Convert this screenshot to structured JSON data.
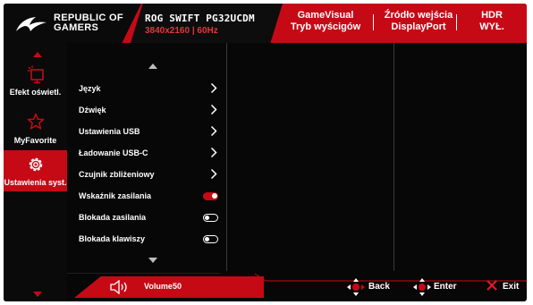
{
  "header": {
    "brand_line1": "REPUBLIC OF",
    "brand_line2": "GAMERS",
    "model": "ROG SWIFT PG32UCDM",
    "resolution": "3840x2160 | 60Hz",
    "preset_line1": "GameVisual",
    "preset_line2": "Tryb wyścigów",
    "input_line1": "Źródło wejścia",
    "input_line2": "DisplayPort",
    "hdr_line1": "HDR",
    "hdr_line2": "WYŁ."
  },
  "nav": {
    "items": [
      {
        "label": "Efekt oświetl.",
        "icon": "lighting-effect-icon",
        "active": false
      },
      {
        "label": "MyFavorite",
        "icon": "star-icon",
        "active": false
      },
      {
        "label": "Ustawienia syst.",
        "icon": "gear-icon",
        "active": true
      }
    ]
  },
  "menu": {
    "items": [
      {
        "label": "Język",
        "control": "submenu"
      },
      {
        "label": "Dźwięk",
        "control": "submenu"
      },
      {
        "label": "Ustawienia USB",
        "control": "submenu"
      },
      {
        "label": "Ładowanie USB-C",
        "control": "submenu"
      },
      {
        "label": "Czujnik zbliżeniowy",
        "control": "submenu"
      },
      {
        "label": "Wskaźnik zasilania",
        "control": "toggle",
        "on": true
      },
      {
        "label": "Blokada zasilania",
        "control": "toggle",
        "on": false
      },
      {
        "label": "Blokada klawiszy",
        "control": "toggle",
        "on": false
      }
    ]
  },
  "footer": {
    "volume_label": "Volume",
    "volume_value": "50",
    "back_label": "Back",
    "enter_label": "Enter",
    "exit_label": "Exit"
  },
  "colors": {
    "accent": "#c50a16",
    "background": "#070707",
    "text": "#ffffff"
  }
}
